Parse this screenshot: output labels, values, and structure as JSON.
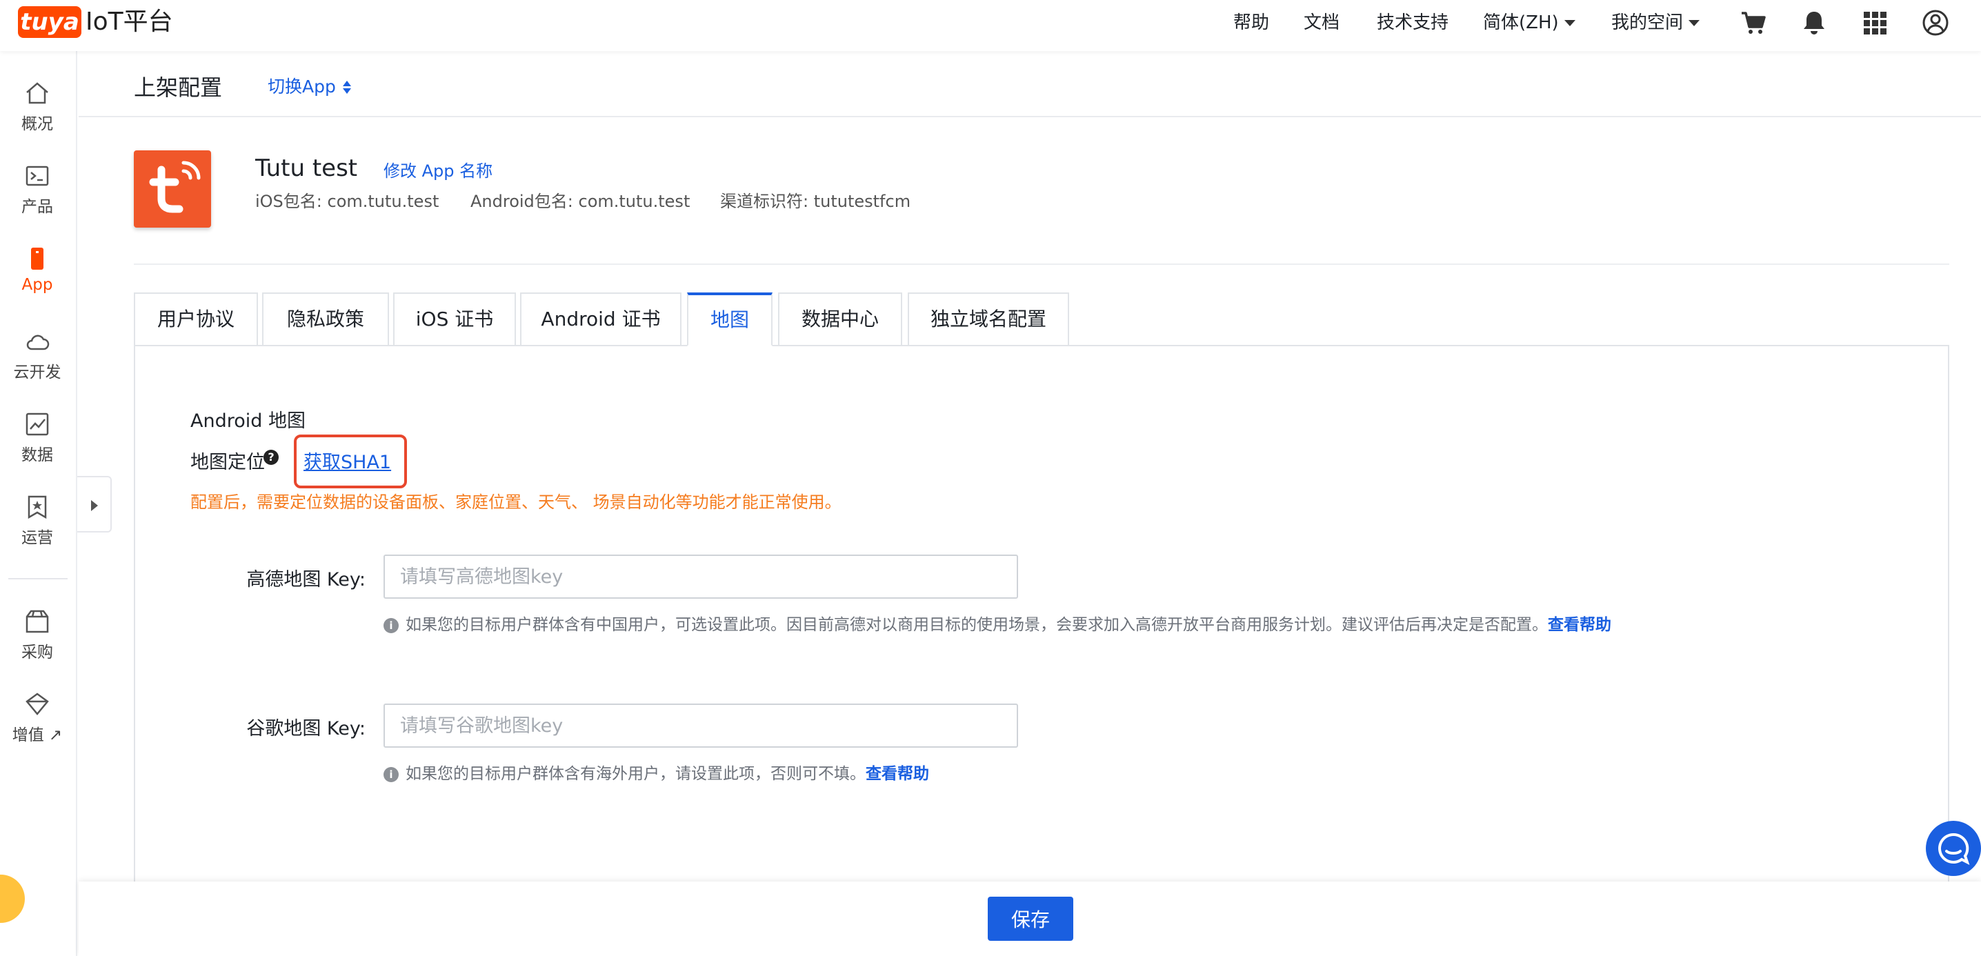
{
  "brand": {
    "logo": "tuya",
    "name": "IoT平台"
  },
  "topnav": {
    "help": "帮助",
    "docs": "文档",
    "support": "技术支持",
    "language": "简体(ZH)",
    "workspace": "我的空间"
  },
  "sidebar": {
    "items": [
      {
        "label": "概况",
        "icon": "home-icon"
      },
      {
        "label": "产品",
        "icon": "terminal-icon"
      },
      {
        "label": "App",
        "icon": "phone-icon"
      },
      {
        "label": "云开发",
        "icon": "cloud-icon"
      },
      {
        "label": "数据",
        "icon": "chart-icon"
      },
      {
        "label": "运营",
        "icon": "star-icon"
      },
      {
        "label": "采购",
        "icon": "box-icon"
      },
      {
        "label": "增值",
        "icon": "diamond-icon"
      }
    ],
    "external_arrow": "↗"
  },
  "header": {
    "title": "上架配置",
    "switch_app": "切换App"
  },
  "app": {
    "name": "Tutu test",
    "rename": "修改 App 名称",
    "ios_package": "iOS包名: com.tutu.test",
    "android_package": "Android包名: com.tutu.test",
    "channel_id": "渠道标识符: tututestfcm"
  },
  "tabs": [
    {
      "label": "用户协议"
    },
    {
      "label": "隐私政策"
    },
    {
      "label": "iOS 证书"
    },
    {
      "label": "Android 证书"
    },
    {
      "label": "地图"
    },
    {
      "label": "数据中心"
    },
    {
      "label": "独立域名配置"
    }
  ],
  "active_tab": "地图",
  "map": {
    "section_title": "Android 地图",
    "location_label": "地图定位",
    "help_mark": "?",
    "get_sha1": "获取SHA1",
    "warning": "配置后，需要定位数据的设备面板、家庭位置、天气、 场景自动化等功能才能正常使用。",
    "amap": {
      "label": "高德地图 Key:",
      "placeholder": "请填写高德地图key",
      "value": "",
      "hint": "如果您的目标用户群体含有中国用户，可选设置此项。因目前高德对以商用目标的使用场景，会要求加入高德开放平台商用服务计划。建议评估后再决定是否配置。",
      "help_link": "查看帮助"
    },
    "google": {
      "label": "谷歌地图 Key:",
      "placeholder": "请填写谷歌地图key",
      "value": "",
      "hint": "如果您的目标用户群体含有海外用户，请设置此项，否则可不填。",
      "help_link": "查看帮助"
    }
  },
  "footer": {
    "save": "保存"
  },
  "colors": {
    "accent": "#1a5fe0",
    "brand": "#ff4800",
    "warning": "#f57c1f",
    "highlight_box": "#e8472d"
  }
}
